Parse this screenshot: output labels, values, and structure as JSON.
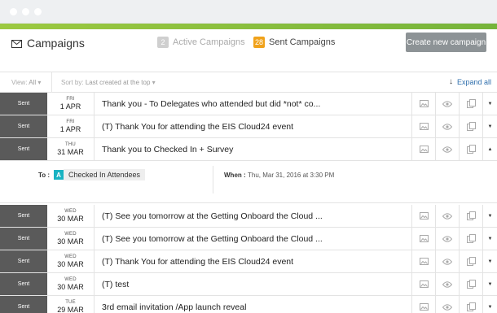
{
  "header": {
    "title": "Campaigns",
    "active_count": "2",
    "active_label": "Active Campaigns",
    "sent_count": "28",
    "sent_label": "Sent Campaigns",
    "create_button": "Create new campaign"
  },
  "filters": {
    "view_prefix": "View:",
    "view_value": "All",
    "sort_prefix": "Sort by:",
    "sort_value": "Last created at the top",
    "expand_all": "Expand all"
  },
  "rows": [
    {
      "status": "Sent",
      "dow": "FRI",
      "date": "1 APR",
      "name": "Thank you - To Delegates who attended but did *not* co..."
    },
    {
      "status": "Sent",
      "dow": "FRI",
      "date": "1 APR",
      "name": "(T) Thank You for attending the EIS Cloud24 event"
    },
    {
      "status": "Sent",
      "dow": "THU",
      "date": "31 MAR",
      "name": "Thank you to Checked In + Survey"
    },
    {
      "status": "Sent",
      "dow": "WED",
      "date": "30 MAR",
      "name": "(T) See you tomorrow at the Getting Onboard the Cloud ..."
    },
    {
      "status": "Sent",
      "dow": "WED",
      "date": "30 MAR",
      "name": "(T) See you tomorrow at the Getting Onboard the Cloud ..."
    },
    {
      "status": "Sent",
      "dow": "WED",
      "date": "30 MAR",
      "name": "(T) Thank You for attending the EIS Cloud24 event"
    },
    {
      "status": "Sent",
      "dow": "WED",
      "date": "30 MAR",
      "name": "(T) test"
    },
    {
      "status": "Sent",
      "dow": "TUE",
      "date": "29 MAR",
      "name": "3rd email invitation /App launch reveal"
    }
  ],
  "detail": {
    "to_label": "To :",
    "recipient_badge": "A",
    "recipient_name": "Checked In Attendees",
    "when_label": "When :",
    "when_value": "Thu, Mar 31, 2016 at 3:30 PM"
  },
  "colors": {
    "accent_green": "#8cc63f",
    "sent_badge": "#f0a21b",
    "status_bg": "#5a5a5a",
    "recipient_badge": "#19b3c2",
    "create_button": "#8d9396"
  }
}
